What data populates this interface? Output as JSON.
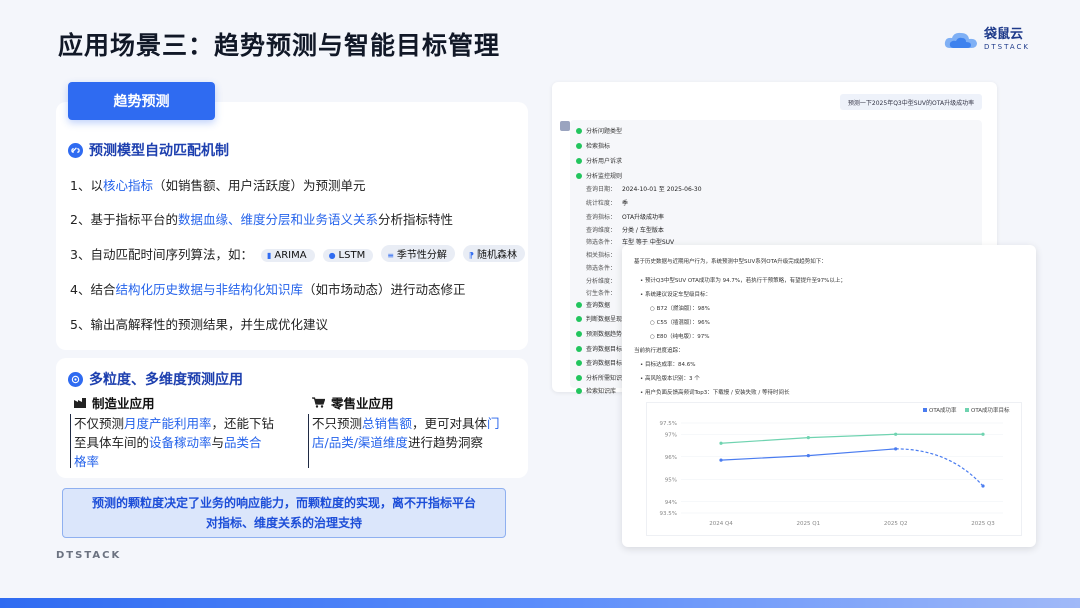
{
  "title": "应用场景三：趋势预测与智能目标管理",
  "logo": {
    "cn": "袋鼠云",
    "en": "DTSTACK"
  },
  "tab_label": "趋势预测",
  "section1": {
    "heading": "预测模型自动匹配机制",
    "items": [
      {
        "num": "1、以",
        "hl": "核心指标",
        "rest": "（如销售额、用户活跃度）为预测单元"
      },
      {
        "num": "2、基于指标平台的",
        "hl": "数据血缘、维度分层和业务语义关系",
        "rest": "分析指标特性"
      },
      {
        "num": "3、自动匹配时间序列算法，如：",
        "hl": "",
        "rest": ""
      },
      {
        "num": "4、结合",
        "hl": "结构化历史数据与非结构化知识库",
        "rest": "（如市场动态）进行动态修正"
      },
      {
        "num": "5、输出高解释性的预测结果，并生成优化建议",
        "hl": "",
        "rest": ""
      }
    ],
    "algos": [
      "ARIMA",
      "LSTM",
      "季节性分解",
      "随机森林"
    ]
  },
  "section2": {
    "heading": "多粒度、多维度预测应用",
    "mfg": {
      "title": "制造业应用",
      "p1": "不仅预测",
      "h1": "月度产能利用率",
      "p2": "，还能下钻",
      "p3": "至具体车间的",
      "h2": "设备稼动率",
      "p4": "与",
      "h3": "品类合",
      "h3b": "格率"
    },
    "retail": {
      "title": "零售业应用",
      "p1": "不只预测",
      "h1": "总销售额",
      "p2": "，更可对具体",
      "h2": "门",
      "h2b": "店/品类/渠道维度",
      "p3": "进行趋势洞察"
    }
  },
  "banner": {
    "line1": "预测的颗粒度决定了业务的响应能力，而颗粒度的实现，离不开指标平台",
    "line2": "对指标、维度关系的治理支持"
  },
  "footer_logo": "DTSTACK",
  "screenshot": {
    "query": "预测一下2025年Q3中型SUV的OTA升级成功率",
    "steps_top": [
      "分析问题类型",
      "检索指标",
      "分析用户诉求",
      "分析监控规则"
    ],
    "params": [
      {
        "k": "查询日期：",
        "v": "2024-10-01 至 2025-06-30"
      },
      {
        "k": "统计粒度：",
        "v": "季"
      },
      {
        "k": "查询指标：",
        "v": "OTA升级成功率"
      },
      {
        "k": "查询维度：",
        "v": "分类 / 车型版本"
      },
      {
        "k": "筛选条件：",
        "v": "车型 等于 中型SUV"
      },
      {
        "k": "相关指标：",
        "v": ""
      },
      {
        "k": "筛选条件：",
        "v": "详"
      },
      {
        "k": "分析维度：",
        "v": ""
      },
      {
        "k": "衍生条件：",
        "v": "Ta"
      }
    ],
    "steps_bottom": [
      "查询数据",
      "判断数据呈现",
      "预测数据趋势",
      "查询数据目标",
      "查询数据目标",
      "分析所需知识",
      "检索知识库"
    ],
    "result": {
      "intro": "基于历史数据与近期用户行为，系统预测中型SUV系列OTA升级完成趋势如下：",
      "b1": "预计Q3中型SUV OTA成功率为 94.7%，若执行干预策略，有望提升至97%以上；",
      "b2": "系统建议设定车型级目标：",
      "targets": [
        "B72（燃油版）：98%",
        "C55（插混版）：96%",
        "E80（纯电版）：97%"
      ],
      "progress": "当前执行进度追踪：",
      "p1": "目标达成率：84.6%",
      "p2": "高风险版本识别：3 个",
      "p3": "用户负面反馈高频词Top3：下载慢 / 安装失败 / 等待时间长"
    }
  },
  "chart_data": {
    "type": "line",
    "categories": [
      "2024 Q4",
      "2025 Q1",
      "2025 Q2",
      "2025 Q3"
    ],
    "series": [
      {
        "name": "OTA成功率",
        "values": [
          95.85,
          96.05,
          96.35,
          94.7
        ],
        "color": "#4a7cf0",
        "forecast_from": 2
      },
      {
        "name": "OTA成功率目标",
        "values": [
          96.6,
          96.85,
          97.0,
          97.0
        ],
        "color": "#6fd3b0"
      }
    ],
    "y_ticks": [
      "97.5%",
      "97%",
      "96%",
      "95%",
      "94%",
      "93.5%"
    ],
    "y_tick_values": [
      97.5,
      97,
      96,
      95,
      94,
      93.5
    ],
    "ylim": [
      93.5,
      97.5
    ],
    "legend": "top-right"
  }
}
